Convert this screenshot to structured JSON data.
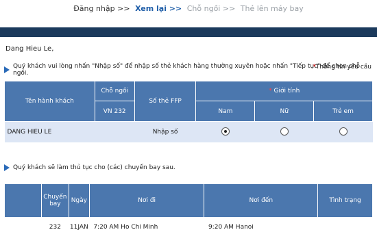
{
  "steps": [
    {
      "label": "Đăng nhập >>",
      "state": "done"
    },
    {
      "label": "Xem lại >>",
      "state": "current"
    },
    {
      "label": "Chỗ ngồi >>",
      "state": "todo"
    },
    {
      "label": "Thẻ lên máy bay",
      "state": "todo"
    }
  ],
  "greeting": "Dang Hieu Le,",
  "instruction": "Quý khách vui lòng nhấn \"Nhập số\" để nhập số thẻ khách hàng thường xuyên hoặc nhấn \"Tiếp tục\" để chọn chỗ ngồi.",
  "required_note": {
    "star": "*",
    "text": "Thông tin yêu cầu"
  },
  "passenger_table": {
    "headers": {
      "name": "Tên hành khách",
      "seat": "Chỗ ngồi",
      "seat_flight": "VN 232",
      "ffp": "Số thẻ FFP",
      "gender_star": "*",
      "gender": "Giới tính",
      "male": "Nam",
      "female": "Nữ",
      "child": "Trẻ em"
    },
    "row": {
      "name": "DANG HIEU LE",
      "seat": "",
      "ffp_link": "Nhập số",
      "selected": "male"
    }
  },
  "flight_note": "Quý khách sẽ làm thủ tục cho (các) chuyến bay sau.",
  "flight_table": {
    "headers": {
      "flight": "Chuyến bay",
      "date": "Ngày",
      "from": "Nơi đi",
      "to": "Nơi đến",
      "status": "Tình trạng"
    },
    "rows": [
      {
        "flight": "232",
        "date": "11JAN",
        "from": "7:20 AM  Ho Chi Minh",
        "to": "9:20 AM  Hanoi",
        "status": ""
      }
    ]
  },
  "colors": {
    "header_bg": "#4b77ae",
    "top_bar": "#1b3a5c",
    "row_bg": "#dde6f5",
    "current_step": "#1f5ea8"
  }
}
